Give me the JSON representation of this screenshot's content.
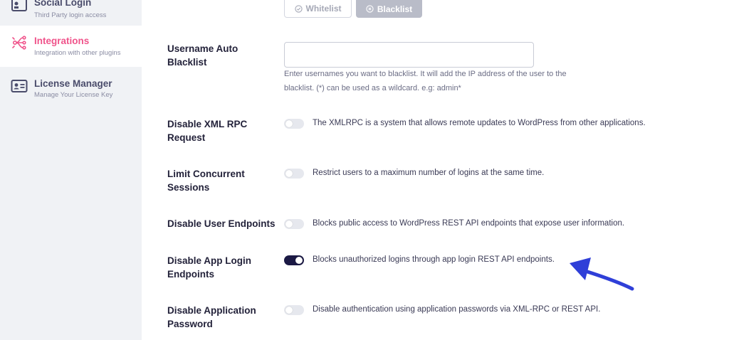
{
  "sidebar": {
    "items": [
      {
        "title": "Social Login",
        "subtitle": "Third Party login access",
        "icon": "social-login-icon",
        "active": false
      },
      {
        "title": "Integrations",
        "subtitle": "Integration with other plugins",
        "icon": "integrations-icon",
        "active": true
      },
      {
        "title": "License Manager",
        "subtitle": "Manage Your License Key",
        "icon": "license-card-icon",
        "active": false
      }
    ]
  },
  "list_mode": {
    "whitelist_label": "Whitelist",
    "blacklist_label": "Blacklist",
    "selected": "Blacklist"
  },
  "settings": {
    "username_blacklist": {
      "label_line1": "Username Auto",
      "label_line2": "Blacklist",
      "value": "",
      "help_line1": "Enter usernames you want to blacklist. It will add the IP address of the user to the",
      "help_line2": "blacklist. (*) can be used as a wildcard. e.g: admin*"
    },
    "xml_rpc": {
      "label_line1": "Disable XML RPC",
      "label_line2": "Request",
      "enabled": false,
      "description": "The XMLRPC is a system that allows remote updates to WordPress from other applications."
    },
    "concurrent_sessions": {
      "label_line1": "Limit Concurrent",
      "label_line2": "Sessions",
      "enabled": false,
      "description": "Restrict users to a maximum number of logins at the same time."
    },
    "user_endpoints": {
      "label_line1": "Disable User Endpoints",
      "enabled": false,
      "description": "Blocks public access to WordPress REST API endpoints that expose user information."
    },
    "app_login_endpoints": {
      "label_line1": "Disable App Login",
      "label_line2": "Endpoints",
      "enabled": true,
      "description": "Blocks unauthorized logins through app login REST API endpoints."
    },
    "application_password": {
      "label_line1": "Disable Application",
      "label_line2": "Password",
      "enabled": false,
      "description": "Disable authentication using application passwords via XML-RPC or REST API."
    }
  },
  "colors": {
    "accent_pink": "#f0548b",
    "toggle_on": "#1b1944",
    "toggle_off": "#e6e8ee",
    "arrow_blue": "#2f3fd8",
    "sidebar_bg": "#f0f2f5"
  }
}
